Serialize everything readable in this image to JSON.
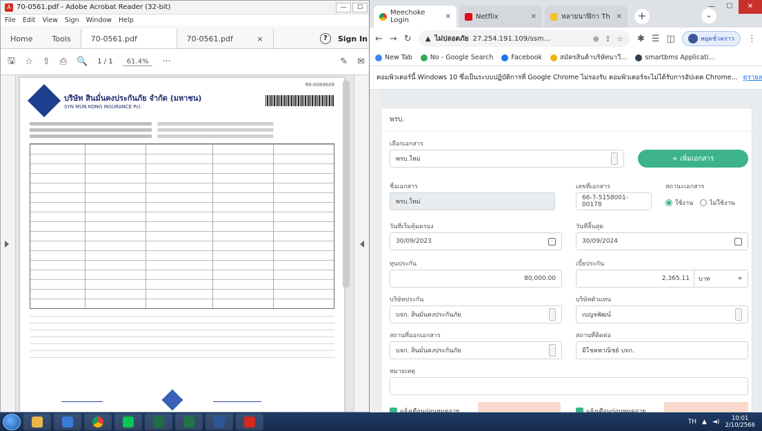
{
  "acrobat": {
    "title": "70-0561.pdf - Adobe Acrobat Reader (32-bit)",
    "menu": [
      "File",
      "Edit",
      "View",
      "Sign",
      "Window",
      "Help"
    ],
    "tabs": {
      "home": "Home",
      "tools": "Tools",
      "file1": "70-0561.pdf",
      "file2": "70-0561.pdf",
      "sign_in": "Sign In"
    },
    "page_indicator": "1 / 1",
    "zoom": "61.4%",
    "doc": {
      "company_th": "บริษัท สินมั่นคงประกันภัย จำกัด (มหาชน)",
      "company_en": "SYN MUN KONG INSURANCE Pcl.",
      "doc_number": "99-0084609"
    }
  },
  "chrome": {
    "tabs": [
      {
        "label": "Meechoke Login",
        "icon": "chrome-icon"
      },
      {
        "label": "Netflix",
        "icon": "netflix-icon"
      },
      {
        "label": "หลายนาฬิกา Th",
        "icon": "yellow-icon"
      }
    ],
    "address": {
      "security": "ไม่ปลอดภัย",
      "url": "27.254.191.109/ssm..."
    },
    "profile": "หยุดชั่วคราว",
    "bookmarks": [
      {
        "label": "New Tab",
        "color": "#4285f4"
      },
      {
        "label": "No - Google Search",
        "color": "#34a853"
      },
      {
        "label": "Facebook",
        "color": "#1877f2"
      },
      {
        "label": "สมัครสินค้าบริษัทนาวี...",
        "color": "#f4b400"
      },
      {
        "label": "smartbms Applicati...",
        "color": "#2c3e50"
      }
    ],
    "infobar": {
      "message": "คอมพิวเตอร์นี้ Windows 10 ซึ่งเป็นระบบปฏิบัติการที่ Google Chrome ไม่รองรับ คอมพิวเตอร์จะไม่ได้รับการอัปเดต Chrome...",
      "link": "ดูรายละเอียด"
    }
  },
  "form": {
    "card_title": "พรบ.",
    "doc_type_label": "เลือกเอกสาร",
    "doc_type_value": "พรบ.ใหม่",
    "add_doc_button": "+ เพิ่มเอกสาร",
    "doc_name_label": "ชื่อเอกสาร",
    "doc_name_value": "พรบ.ใหม่",
    "doc_number_label": "เลขที่เอกสาร",
    "doc_number_value": "66-7-5158001-00178",
    "status_label": "สถานะเอกสาร",
    "status_yes": "ใช้งาน",
    "status_no": "ไม่ใช้งาน",
    "start_label": "วันที่เริ่มคุ้มครอง",
    "start_value": "30/09/2023",
    "end_label": "วันที่สิ้นสุด",
    "end_value": "30/09/2024",
    "coverage_label": "ทุนประกัน",
    "coverage_value": "80,000.00",
    "premium_label": "เบี้ยประกัน",
    "premium_value": "2,365.11",
    "premium_unit": "บาท",
    "insurer_label": "บริษัทประกัน",
    "insurer_value": "บจก. สินมั่นคงประกันภัย",
    "agent_label": "บริษัทตัวแทน",
    "agent_value": "เบญจพัฒน์",
    "issuer_label": "สถานที่ออกเอกสาร",
    "issuer_value": "บจก. สินมั่นคงประกันภัย",
    "contact_label": "สถานที่ติดต่อ",
    "contact_value": "มีโชคพาณิชย์ บจก.",
    "note_label": "หมายเหตุ",
    "check1": "แจ้งเตือนก่อนหมดอายุ",
    "check2": "แจ้งเตือนก่อนหมดอายุ"
  },
  "taskbar": {
    "lang": "TH",
    "time": "10:01",
    "date": "2/10/2566"
  },
  "colors": {
    "accent": "#3cb38a"
  }
}
